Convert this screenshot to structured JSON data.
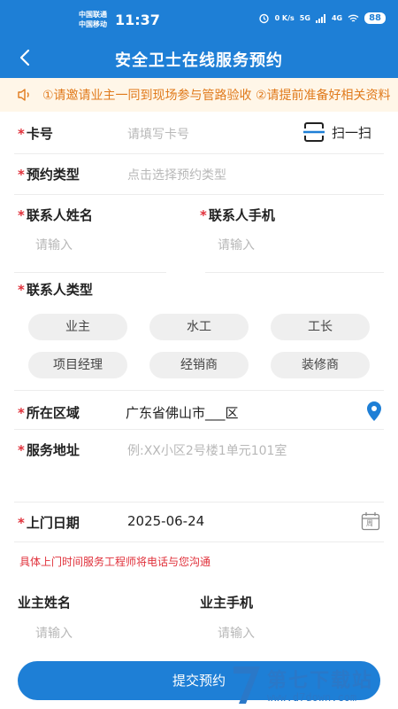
{
  "status_bar": {
    "carrier_1": "中国联通",
    "carrier_2": "中国移动",
    "time": "11:37",
    "net_speed": "0 K/s",
    "signal_1": "5G",
    "signal_2": "4G",
    "battery": "88"
  },
  "header": {
    "title": "安全卫士在线服务预约"
  },
  "notice": {
    "text": "①请邀请业主一同到现场参与管路验收 ②请提前准备好相关资料"
  },
  "form": {
    "card": {
      "label": "卡号",
      "placeholder": "请填写卡号",
      "scan_label": "扫一扫"
    },
    "booking_type": {
      "label": "预约类型",
      "placeholder": "点击选择预约类型"
    },
    "contact_name": {
      "label": "联系人姓名",
      "placeholder": "请输入"
    },
    "contact_phone": {
      "label": "联系人手机",
      "placeholder": "请输入"
    },
    "contact_type": {
      "label": "联系人类型",
      "options": [
        "业主",
        "水工",
        "工长",
        "项目经理",
        "经销商",
        "装修商"
      ]
    },
    "area": {
      "label": "所在区域",
      "value": "广东省佛山市___区"
    },
    "address": {
      "label": "服务地址",
      "placeholder": "例:XX小区2号楼1单元101室"
    },
    "date": {
      "label": "上门日期",
      "value": "2025-06-24",
      "calendar_text": "周"
    },
    "tip": "具体上门时间服务工程师将电话与您沟通",
    "owner_name": {
      "label": "业主姓名",
      "placeholder": "请输入"
    },
    "owner_phone": {
      "label": "业主手机",
      "placeholder": "请输入"
    },
    "required_mark": "*",
    "submit_label": "提交预约"
  },
  "watermark": {
    "brand": "第七下载站",
    "url": "www.d7down.com"
  },
  "colors": {
    "primary": "#1e7fd6",
    "notice_bg": "#fff6e8",
    "notice_text": "#e07a1c",
    "required": "#e0303a"
  }
}
